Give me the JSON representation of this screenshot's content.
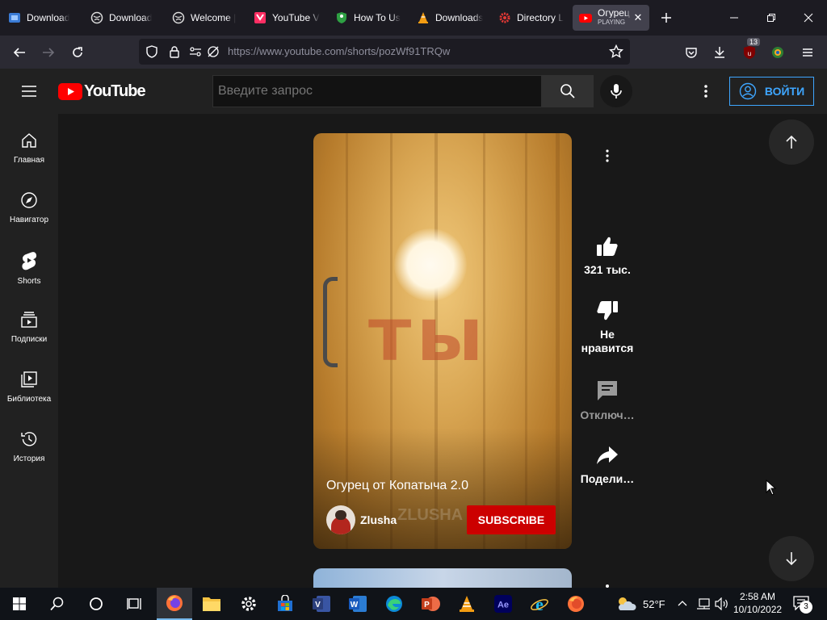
{
  "browser": {
    "tabs": [
      {
        "label": "Download",
        "favicon": "windows-tools-icon",
        "color": "#3a7bd5"
      },
      {
        "label": "Download",
        "favicon": "world-icon",
        "color": "#cccccc"
      },
      {
        "label": "Welcome |",
        "favicon": "world-icon",
        "color": "#cccccc"
      },
      {
        "label": "YouTube V",
        "favicon": "ytv-icon",
        "color": "#ff2e63"
      },
      {
        "label": "How To Us",
        "favicon": "shield-green-icon",
        "color": "#2ea043"
      },
      {
        "label": "Downloads",
        "favicon": "vlc-icon",
        "color": "#f39c12"
      },
      {
        "label": "Directory L",
        "favicon": "gear-red-icon",
        "color": "#e53935"
      }
    ],
    "active_tab": {
      "label": "Огурец",
      "sublabel": "PLAYING",
      "favicon": "youtube-icon"
    },
    "url": "https://www.youtube.com/shorts/pozWf91TRQw",
    "extension_badge": "13"
  },
  "youtube": {
    "logo_text": "YouTube",
    "search_placeholder": "Введите запрос",
    "signin_label": "ВОЙТИ",
    "sidebar": [
      {
        "label": "Главная",
        "icon": "home-icon"
      },
      {
        "label": "Навигатор",
        "icon": "compass-icon"
      },
      {
        "label": "Shorts",
        "icon": "shorts-icon"
      },
      {
        "label": "Подписки",
        "icon": "subscriptions-icon"
      },
      {
        "label": "Библиотека",
        "icon": "library-icon"
      },
      {
        "label": "История",
        "icon": "history-icon"
      }
    ],
    "short": {
      "overlay_text": "ты",
      "title": "Огурец от Копатыча 2.0",
      "channel": "Zlusha",
      "watermark": "ZLUSHA",
      "subscribe_label": "SUBSCRIBE"
    },
    "actions": {
      "likes": "321 тыс.",
      "dislike_label": "Не\nнравится",
      "comments_label": "Отключ…",
      "share_label": "Подели…"
    },
    "accent": "#ff0000",
    "link_blue": "#3ea6ff"
  },
  "taskbar": {
    "temperature": "52°F",
    "time": "2:58 AM",
    "date": "10/10/2022",
    "notifications": "3"
  }
}
